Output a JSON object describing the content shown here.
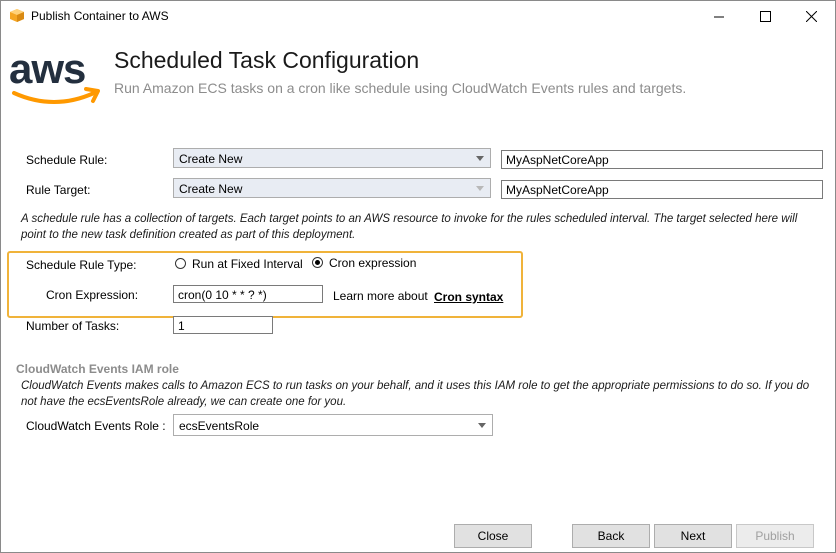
{
  "window": {
    "title": "Publish Container to AWS"
  },
  "header": {
    "logo_text": "aws",
    "title": "Scheduled Task Configuration",
    "subtitle": "Run Amazon ECS tasks on a cron like schedule using CloudWatch Events rules and targets."
  },
  "schedule_rule": {
    "label": "Schedule Rule:",
    "selected": "Create New",
    "name_value": "MyAspNetCoreApp"
  },
  "rule_target": {
    "label": "Rule Target:",
    "selected": "Create New",
    "name_value": "MyAspNetCoreApp"
  },
  "rule_description": {
    "line1": "A schedule rule has a collection of targets. Each target points to an AWS resource to invoke for the rules scheduled interval. The target selected here will",
    "line2": "point to the new task definition created as part of this deployment."
  },
  "schedule_type": {
    "label": "Schedule Rule Type:",
    "option_fixed": "Run at Fixed Interval",
    "option_cron": "Cron expression",
    "selected": "Cron expression"
  },
  "cron": {
    "label": "Cron Expression:",
    "value": "cron(0 10 * * ? *)",
    "learn_more": "Learn more about",
    "link": "Cron syntax"
  },
  "tasks": {
    "label": "Number of Tasks:",
    "value": "1"
  },
  "iam": {
    "heading": "CloudWatch Events IAM role",
    "line1": "CloudWatch Events makes calls to Amazon ECS to run tasks on your behalf, and it uses this IAM role to get the appropriate permissions to do so. If you do",
    "line2": "not have the ecsEventsRole already, we can create one for you.",
    "role_label": "CloudWatch Events Role :",
    "role_value": "ecsEventsRole"
  },
  "buttons": {
    "close": "Close",
    "back": "Back",
    "next": "Next",
    "publish": "Publish"
  },
  "colors": {
    "aws_orange": "#ff9900",
    "aws_navy": "#232f3e",
    "highlight": "#f0b33a"
  }
}
